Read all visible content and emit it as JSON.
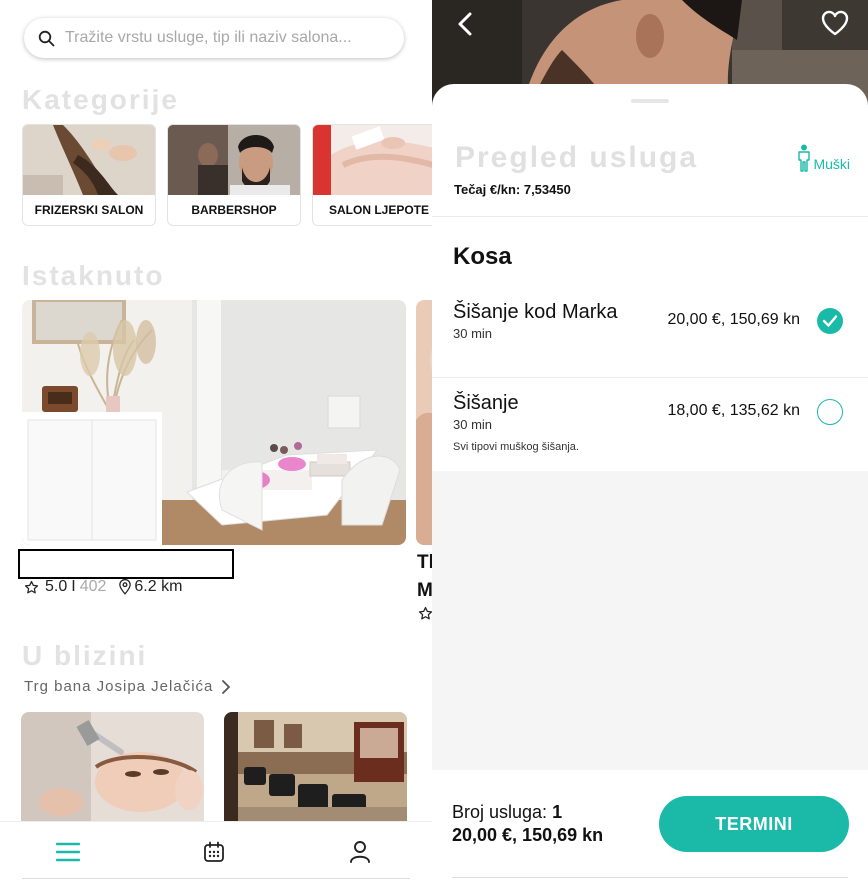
{
  "left_screen": {
    "search": {
      "placeholder": "Tražite vrstu usluge, tip ili naziv salona..."
    },
    "categories": {
      "title": "Kategorije",
      "items": [
        {
          "label": "FRIZERSKI SALON"
        },
        {
          "label": "BARBERSHOP"
        },
        {
          "label": "SALON LJEPOTE"
        }
      ]
    },
    "featured": {
      "title": "Istaknuto",
      "item": {
        "rating": "5.0",
        "separator": "I",
        "reviews": "402",
        "distance": "6.2 km"
      },
      "peek_text_1": "Tl",
      "peek_text_2": "M"
    },
    "nearby": {
      "title": "U blizini",
      "location": "Trg bana Josipa Jelačića"
    },
    "tabbar": {
      "items": [
        {
          "icon": "menu-icon",
          "active": true
        },
        {
          "icon": "calendar-icon",
          "active": false
        },
        {
          "icon": "profile-icon",
          "active": false
        }
      ]
    }
  },
  "right_screen": {
    "header": {
      "back_icon": "chevron-left-icon",
      "favorite_icon": "heart-icon"
    },
    "sheet": {
      "title": "Pregled usluga",
      "exchange_rate": "Tečaj €/kn: 7,53450",
      "gender_filter": "Muški"
    },
    "category": {
      "title": "Kosa",
      "services": [
        {
          "name": "Šišanje kod Marka",
          "duration": "30 min",
          "description": "",
          "price": "20,00 €, 150,69 kn",
          "selected": true
        },
        {
          "name": "Šišanje",
          "duration": "30 min",
          "description": "Svi tipovi muškog šišanja.",
          "price": "18,00 €, 135,62 kn",
          "selected": false
        }
      ]
    },
    "footer": {
      "count_label": "Broj usluga:",
      "count_value": "1",
      "total": "20,00 €, 150,69 kn",
      "button_label": "TERMINI"
    }
  },
  "colors": {
    "accent": "#1bbaa8",
    "muted_title": "#e0e0e0"
  }
}
